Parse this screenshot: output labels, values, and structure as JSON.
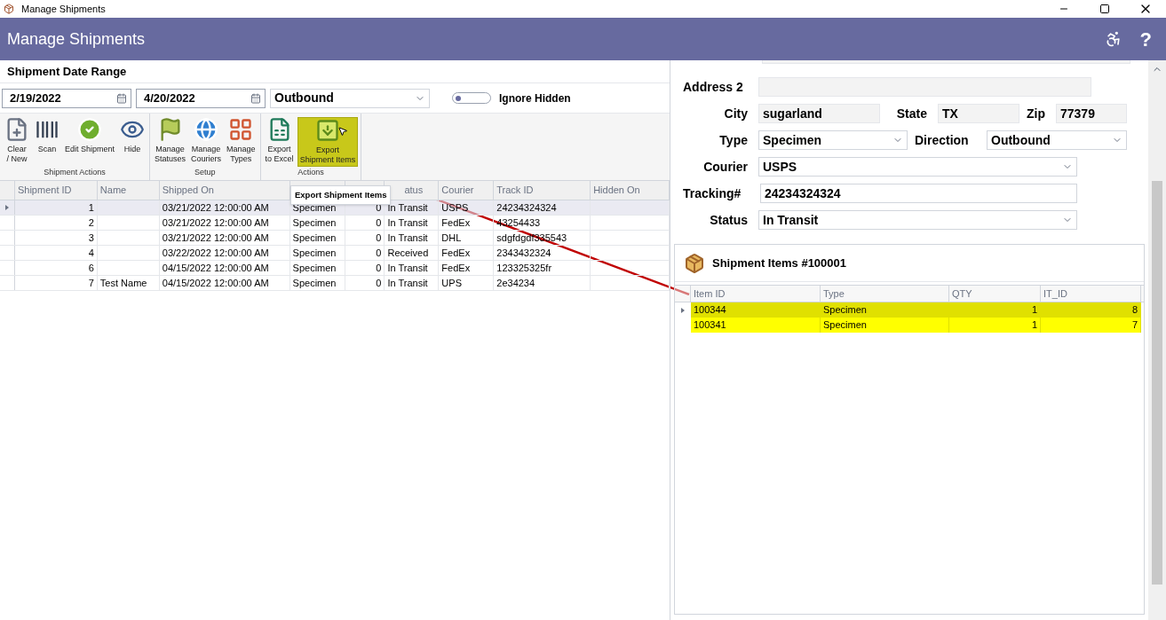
{
  "window": {
    "title": "Manage Shipments"
  },
  "header": {
    "title": "Manage Shipments",
    "help": "?"
  },
  "filters": {
    "section_title": "Shipment Date Range",
    "from_date": "2/19/2022",
    "to_date": "4/20/2022",
    "direction": "Outbound",
    "ignore_hidden": {
      "label": "Ignore Hidden",
      "on": false
    }
  },
  "ribbon": {
    "groups": [
      {
        "label": "Shipment Actions",
        "buttons": [
          {
            "kind": "new",
            "label": "Clear\n/ New",
            "highlighted": false
          },
          {
            "kind": "scan",
            "label": "Scan",
            "highlighted": false
          },
          {
            "kind": "edit",
            "label": "Edit Shipment",
            "highlighted": false
          },
          {
            "kind": "hide",
            "label": "Hide",
            "highlighted": false
          }
        ]
      },
      {
        "label": "Setup",
        "buttons": [
          {
            "kind": "statuses",
            "label": "Manage\nStatuses",
            "highlighted": false
          },
          {
            "kind": "couriers",
            "label": "Manage\nCouriers",
            "highlighted": false
          },
          {
            "kind": "types",
            "label": "Manage\nTypes",
            "highlighted": false
          }
        ]
      },
      {
        "label": "Actions",
        "buttons": [
          {
            "kind": "excel",
            "label": "Export\nto Excel",
            "highlighted": false
          },
          {
            "kind": "export",
            "label": "Export\nShipment Items",
            "highlighted": true
          }
        ]
      }
    ]
  },
  "tooltip": "Export Shipment Items",
  "shipments_table": {
    "columns": [
      {
        "label": "Shipment ID"
      },
      {
        "label": "Name"
      },
      {
        "label": "Shipped On"
      },
      {},
      {},
      {
        "label": "atus"
      },
      {
        "label": "Courier"
      },
      {
        "label": "Track ID"
      },
      {
        "label": "Hidden On"
      }
    ],
    "rows": [
      {
        "selected": true,
        "cells": [
          "1",
          "",
          "03/21/2022 12:00:00 AM",
          "Specimen",
          "0",
          "In Transit",
          "USPS",
          "24234324324",
          ""
        ]
      },
      {
        "selected": false,
        "cells": [
          "2",
          "",
          "03/21/2022 12:00:00 AM",
          "Specimen",
          "0",
          "In Transit",
          "FedEx",
          "43254433",
          ""
        ]
      },
      {
        "selected": false,
        "cells": [
          "3",
          "",
          "03/21/2022 12:00:00 AM",
          "Specimen",
          "0",
          "In Transit",
          "DHL",
          "sdgfdgdf335543",
          ""
        ]
      },
      {
        "selected": false,
        "cells": [
          "4",
          "",
          "03/22/2022 12:00:00 AM",
          "Specimen",
          "0",
          "Received",
          "FedEx",
          "2343432324",
          ""
        ]
      },
      {
        "selected": false,
        "cells": [
          "6",
          "",
          "04/15/2022 12:00:00 AM",
          "Specimen",
          "0",
          "In Transit",
          "FedEx",
          "123325325fr",
          ""
        ]
      },
      {
        "selected": false,
        "cells": [
          "7",
          "Test Name",
          "04/15/2022 12:00:00 AM",
          "Specimen",
          "0",
          "In Transit",
          "UPS",
          "2e34234",
          ""
        ]
      }
    ]
  },
  "details": {
    "address2": {
      "label": "Address 2"
    },
    "city": {
      "label": "City",
      "value": "sugarland"
    },
    "state": {
      "label": "State",
      "value": "TX"
    },
    "zip": {
      "label": "Zip",
      "value": "77379"
    },
    "type": {
      "label": "Type",
      "value": "Specimen"
    },
    "direction": {
      "label": "Direction",
      "value": "Outbound"
    },
    "courier": {
      "label": "Courier",
      "value": "USPS"
    },
    "tracking": {
      "label": "Tracking#",
      "value": "24234324324"
    },
    "status": {
      "label": "Status",
      "value": "In Transit"
    }
  },
  "items": {
    "title": "Shipment Items #100001",
    "columns": [
      "Item ID",
      "Type",
      "QTY",
      "IT_ID"
    ],
    "rows": [
      {
        "selected": true,
        "cells": [
          "100344",
          "Specimen",
          "1",
          "8"
        ]
      },
      {
        "selected": false,
        "cells": [
          "100341",
          "Specimen",
          "1",
          "7"
        ]
      }
    ]
  }
}
